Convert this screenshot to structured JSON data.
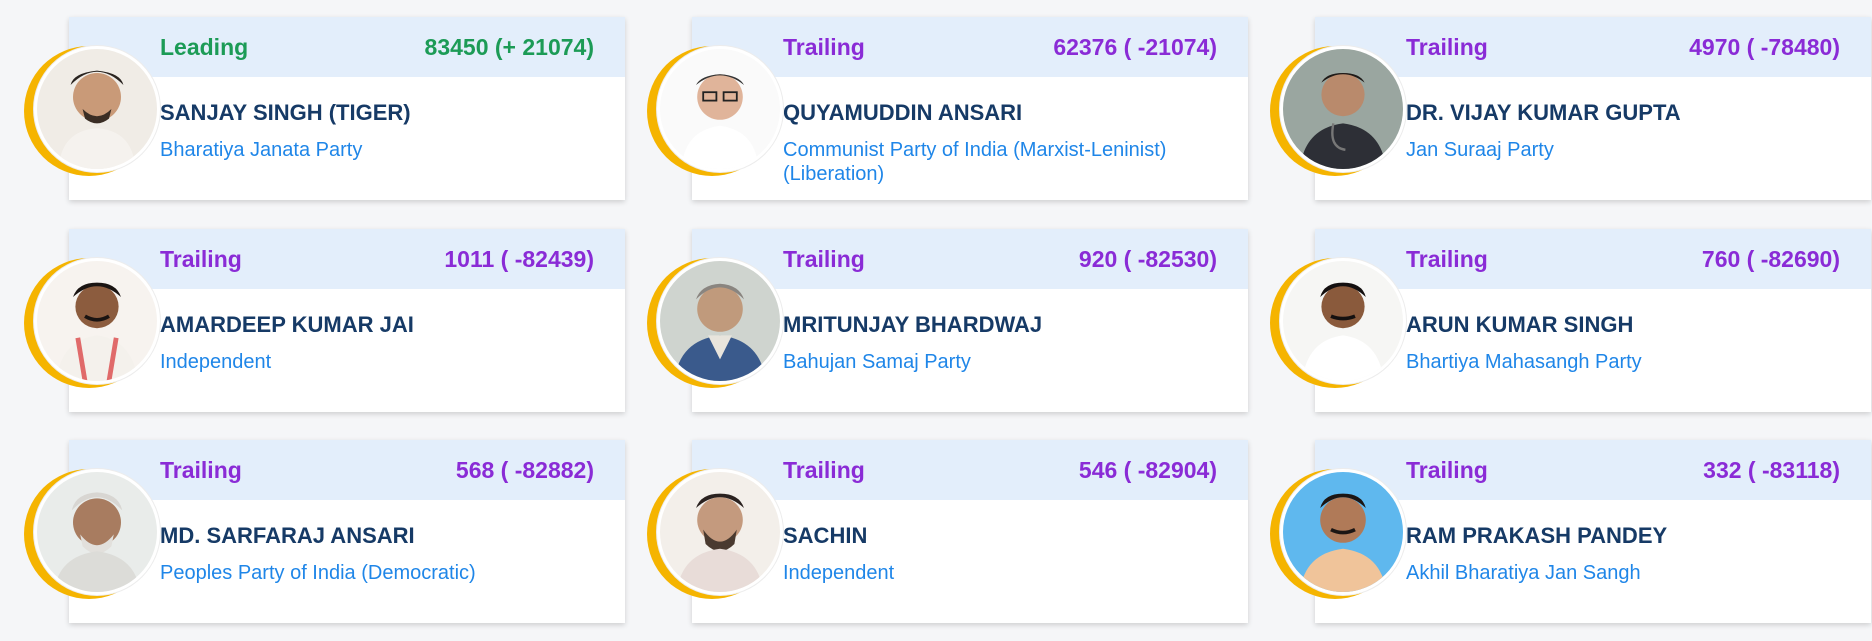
{
  "candidates": [
    {
      "status": "Leading",
      "votes": "83450 (+ 21074)",
      "name": "SANJAY SINGH (TIGER)",
      "party": "Bharatiya Janata Party"
    },
    {
      "status": "Trailing",
      "votes": "62376 ( -21074)",
      "name": "QUYAMUDDIN ANSARI",
      "party": "Communist Party of India (Marxist-Leninist) (Liberation)"
    },
    {
      "status": "Trailing",
      "votes": "4970 ( -78480)",
      "name": "DR. VIJAY KUMAR GUPTA",
      "party": "Jan Suraaj Party"
    },
    {
      "status": "Trailing",
      "votes": "1011 ( -82439)",
      "name": "AMARDEEP KUMAR JAI",
      "party": "Independent"
    },
    {
      "status": "Trailing",
      "votes": "920 ( -82530)",
      "name": "MRITUNJAY BHARDWAJ",
      "party": "Bahujan Samaj Party"
    },
    {
      "status": "Trailing",
      "votes": "760 ( -82690)",
      "name": "ARUN KUMAR SINGH",
      "party": "Bhartiya Mahasangh Party"
    },
    {
      "status": "Trailing",
      "votes": "568 ( -82882)",
      "name": "MD. SARFARAJ ANSARI",
      "party": "Peoples Party of India (Democratic)"
    },
    {
      "status": "Trailing",
      "votes": "546 ( -82904)",
      "name": "SACHIN",
      "party": "Independent"
    },
    {
      "status": "Trailing",
      "votes": "332 ( -83118)",
      "name": "RAM PRAKASH PANDEY",
      "party": "Akhil Bharatiya Jan Sangh"
    }
  ],
  "colors": {
    "leading": "#1c9b56",
    "trailing": "#8a2bd6",
    "name": "#163a66",
    "party": "#1f86e8",
    "accent_ring": "#f5b400",
    "header_bg": "#e3eefb"
  },
  "icons": {
    "photo": "candidate-photo"
  }
}
